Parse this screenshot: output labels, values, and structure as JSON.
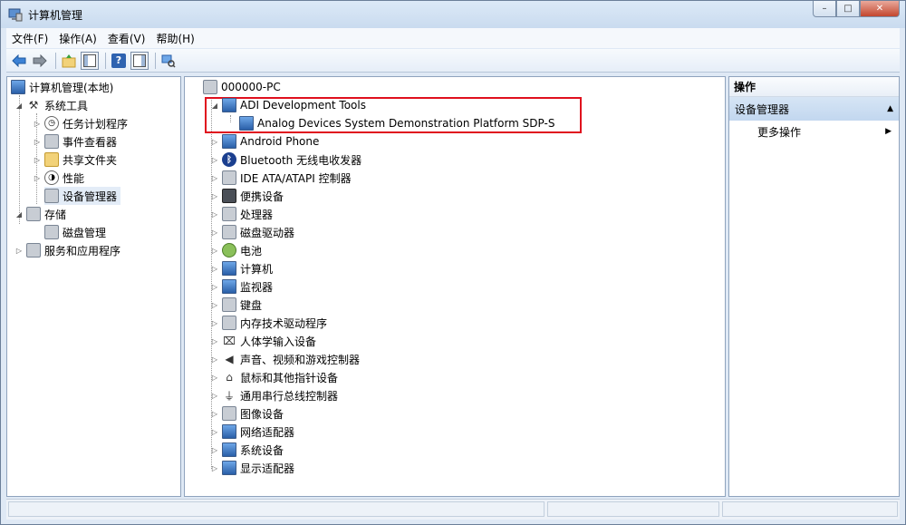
{
  "window": {
    "title": "计算机管理",
    "min": "–",
    "max": "□",
    "close": "✕"
  },
  "menu": [
    "文件(F)",
    "操作(A)",
    "查看(V)",
    "帮助(H)"
  ],
  "toolbar": {
    "help_glyph": "?"
  },
  "left_tree": [
    {
      "label": "计算机管理(本地)",
      "level": 0,
      "expander": "",
      "icon": "computer-icon"
    },
    {
      "label": "系统工具",
      "level": 1,
      "expander": "◢",
      "icon": "tools-icon"
    },
    {
      "label": "任务计划程序",
      "level": 2,
      "expander": "▷",
      "icon": "clock-icon"
    },
    {
      "label": "事件查看器",
      "level": 2,
      "expander": "▷",
      "icon": "event-viewer-icon"
    },
    {
      "label": "共享文件夹",
      "level": 2,
      "expander": "▷",
      "icon": "shared-folder-icon"
    },
    {
      "label": "性能",
      "level": 2,
      "expander": "▷",
      "icon": "performance-icon"
    },
    {
      "label": "设备管理器",
      "level": 2,
      "expander": "",
      "icon": "device-manager-icon",
      "selected": true
    },
    {
      "label": "存储",
      "level": 1,
      "expander": "◢",
      "icon": "storage-icon"
    },
    {
      "label": "磁盘管理",
      "level": 2,
      "expander": "",
      "icon": "disk-management-icon"
    },
    {
      "label": "服务和应用程序",
      "level": 1,
      "expander": "▷",
      "icon": "services-icon"
    }
  ],
  "device_tree": {
    "root": "000000-PC",
    "adi_group": "ADI Development Tools",
    "adi_child": "Analog Devices System Demonstration Platform SDP-S",
    "categories": [
      {
        "label": "Android Phone",
        "icon": "phone-icon"
      },
      {
        "label": "Bluetooth 无线电收发器",
        "icon": "bluetooth-icon"
      },
      {
        "label": "IDE ATA/ATAPI 控制器",
        "icon": "ide-controller-icon"
      },
      {
        "label": "便携设备",
        "icon": "portable-device-icon"
      },
      {
        "label": "处理器",
        "icon": "processor-icon"
      },
      {
        "label": "磁盘驱动器",
        "icon": "disk-drive-icon"
      },
      {
        "label": "电池",
        "icon": "battery-icon"
      },
      {
        "label": "计算机",
        "icon": "computer-icon"
      },
      {
        "label": "监视器",
        "icon": "monitor-icon"
      },
      {
        "label": "键盘",
        "icon": "keyboard-icon"
      },
      {
        "label": "内存技术驱动程序",
        "icon": "memory-icon"
      },
      {
        "label": "人体学输入设备",
        "icon": "hid-icon"
      },
      {
        "label": "声音、视频和游戏控制器",
        "icon": "sound-icon"
      },
      {
        "label": "鼠标和其他指针设备",
        "icon": "mouse-icon"
      },
      {
        "label": "通用串行总线控制器",
        "icon": "usb-icon"
      },
      {
        "label": "图像设备",
        "icon": "imaging-icon"
      },
      {
        "label": "网络适配器",
        "icon": "network-adapter-icon"
      },
      {
        "label": "系统设备",
        "icon": "system-device-icon"
      },
      {
        "label": "显示适配器",
        "icon": "display-adapter-icon"
      }
    ]
  },
  "actions": {
    "header": "操作",
    "group": "设备管理器",
    "more": "更多操作",
    "collapse_arrow": "▲",
    "more_arrow": "▶"
  },
  "glyphs": {
    "collapse": "◢",
    "expand": "▷"
  }
}
